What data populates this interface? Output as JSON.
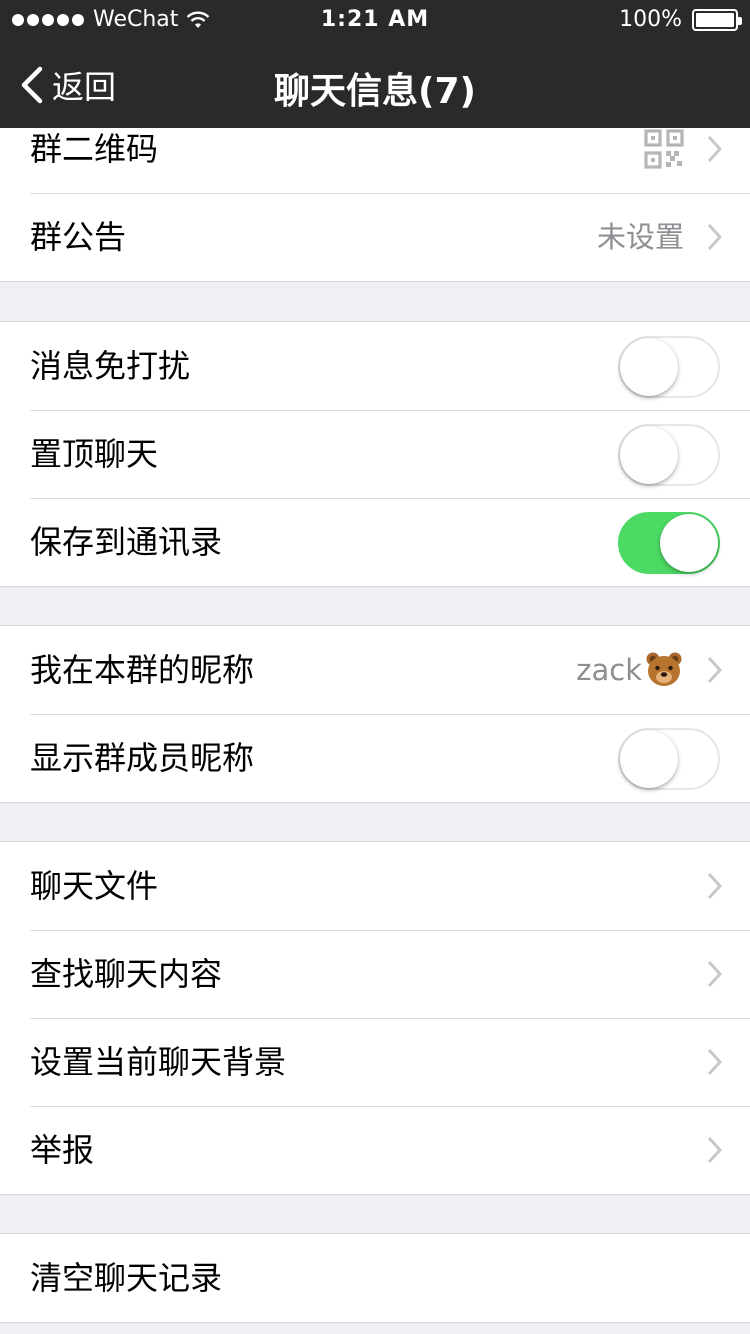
{
  "status_bar": {
    "carrier": "WeChat",
    "time": "1:21 AM",
    "battery": "100%"
  },
  "nav": {
    "back_label": "返回",
    "title": "聊天信息(7)"
  },
  "groups": {
    "g1": {
      "qr_label": "群二维码",
      "notice_label": "群公告",
      "notice_value": "未设置"
    },
    "g2": {
      "mute_label": "消息免打扰",
      "mute_on": false,
      "pin_label": "置顶聊天",
      "pin_on": false,
      "save_label": "保存到通讯录",
      "save_on": true
    },
    "g3": {
      "nickname_label": "我在本群的昵称",
      "nickname_value": "zack",
      "show_nick_label": "显示群成员昵称",
      "show_nick_on": false
    },
    "g4": {
      "files_label": "聊天文件",
      "search_label": "查找聊天内容",
      "bg_label": "设置当前聊天背景",
      "report_label": "举报"
    },
    "g5": {
      "clear_label": "清空聊天记录"
    }
  },
  "colors": {
    "nav_bg": "#2a2a2d",
    "page_bg": "#efeff4",
    "toggle_on": "#4cd964",
    "secondary_text": "#8e8e93"
  },
  "icons": {
    "back": "chevron-left-icon",
    "disclosure": "chevron-right-icon",
    "qr": "qr-code-icon",
    "emoji": "bear-face-emoji"
  }
}
